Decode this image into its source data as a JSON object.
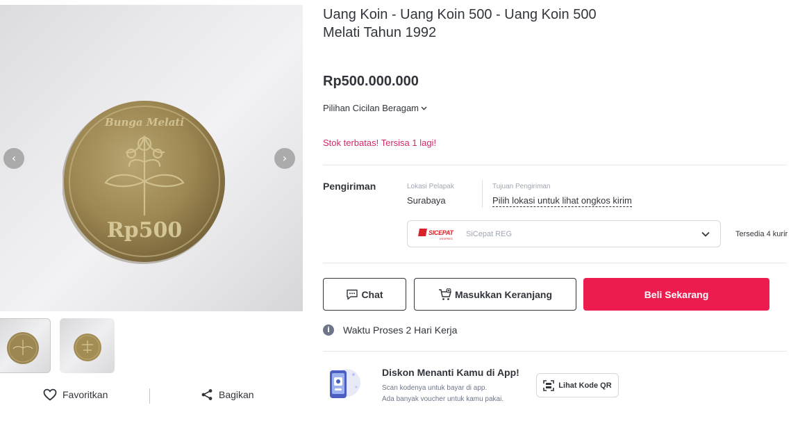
{
  "product": {
    "title": "Uang Koin - Uang Koin 500 - Uang Koin 500 Melati Tahun 1992",
    "price": "Rp500.000.000",
    "installment_label": "Pilihan Cicilan Beragam",
    "stock_notice": "Stok terbatas! Tersisa 1 lagi!"
  },
  "gallery": {
    "coin_text_top": "Bunga Melati",
    "coin_text_value": "Rp500",
    "prev_icon": "chevron-left-icon",
    "next_icon": "chevron-right-icon"
  },
  "social": {
    "favorite_label": "Favoritkan",
    "share_label": "Bagikan"
  },
  "shipping": {
    "section_title": "Pengiriman",
    "origin_label": "Lokasi Pelapak",
    "origin_value": "Surabaya",
    "destination_label": "Tujuan Pengiriman",
    "destination_value": "Pilih lokasi untuk lihat ongkos kirim",
    "courier_brand": "SICEPAT",
    "courier_brand_sub": "EKSPRES",
    "courier_name": "SiCepat REG",
    "available_couriers": "Tersedia 4 kurir"
  },
  "actions": {
    "chat_label": "Chat",
    "cart_label": "Masukkan Keranjang",
    "buy_label": "Beli Sekarang"
  },
  "process": {
    "label": "Waktu Proses 2 Hari Kerja"
  },
  "promo": {
    "title": "Diskon Menanti Kamu di App!",
    "line1": "Scan kodenya untuk bayar di app.",
    "line2": "Ada banyak voucher untuk kamu pakai.",
    "qr_button_label": "Lihat Kode QR"
  },
  "colors": {
    "accent": "#ec1c4f",
    "stock_text": "#d6266b",
    "text_primary": "#31353b",
    "text_muted": "#9fa6b0",
    "coin": "#a08a55"
  }
}
